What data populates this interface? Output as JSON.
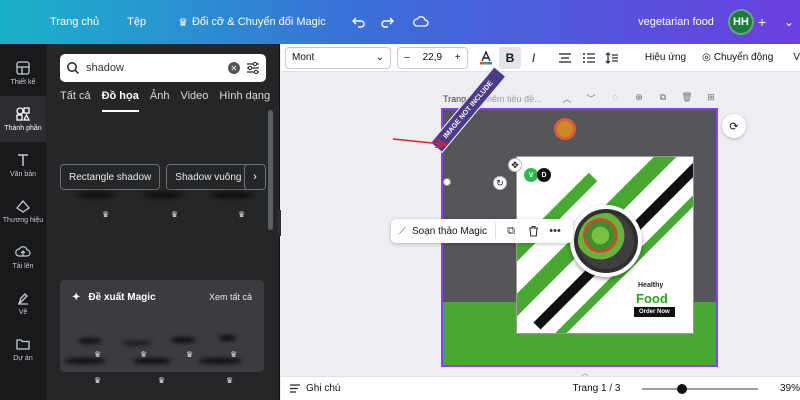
{
  "topbar": {
    "home": "Trang chủ",
    "file": "Tệp",
    "magic": "Đổi cỡ & Chuyển đổi Magic",
    "doc_name": "vegetarian food",
    "avatar": "HH",
    "plus": "+"
  },
  "rail": {
    "items": [
      {
        "label": "Thiết kế",
        "icon": "layout-icon"
      },
      {
        "label": "Thành phần",
        "icon": "shapes-icon"
      },
      {
        "label": "Văn bản",
        "icon": "text-icon"
      },
      {
        "label": "Thương hiệu",
        "icon": "brand-icon"
      },
      {
        "label": "Tải lên",
        "icon": "upload-icon"
      },
      {
        "label": "Vẽ",
        "icon": "draw-icon"
      },
      {
        "label": "Dự án",
        "icon": "folder-icon"
      }
    ]
  },
  "panel": {
    "search_value": "shadow",
    "tabs": [
      "Tất cả",
      "Đồ họa",
      "Ảnh",
      "Video",
      "Hình dạng"
    ],
    "active_tab": "Đồ họa",
    "chips": [
      "Rectangle shadow",
      "Shadow vuông"
    ],
    "magic_title": "Đề xuất Magic",
    "magic_see_all": "Xem tất cả"
  },
  "toolbar": {
    "font": "Mont",
    "font_size": "22,9",
    "minus": "–",
    "plus": "+",
    "bold": "B",
    "italic": "I",
    "effects": "Hiệu ứng",
    "animate": "Chuyển động",
    "more": "V"
  },
  "canvas": {
    "page_label": "Trang 1",
    "page_title_placeholder": "- Thêm tiêu đề...",
    "banner_text": "IMAGE NOT INCLUDE",
    "badge_v": "V",
    "badge_d": "D",
    "healthy": "Healthy",
    "food": "Food",
    "order": "Order Now"
  },
  "context_menu": {
    "magic_edit": "Soạn thảo Magic",
    "more": "•••"
  },
  "bottombar": {
    "notes": "Ghi chú",
    "page_count": "Trang 1 / 3",
    "zoom_label": "39%",
    "zoom_fraction": 0.34
  },
  "colors": {
    "accent_purple": "#8b3dff",
    "brand_green": "#47a832",
    "banner_purple": "#4d3a8a"
  }
}
